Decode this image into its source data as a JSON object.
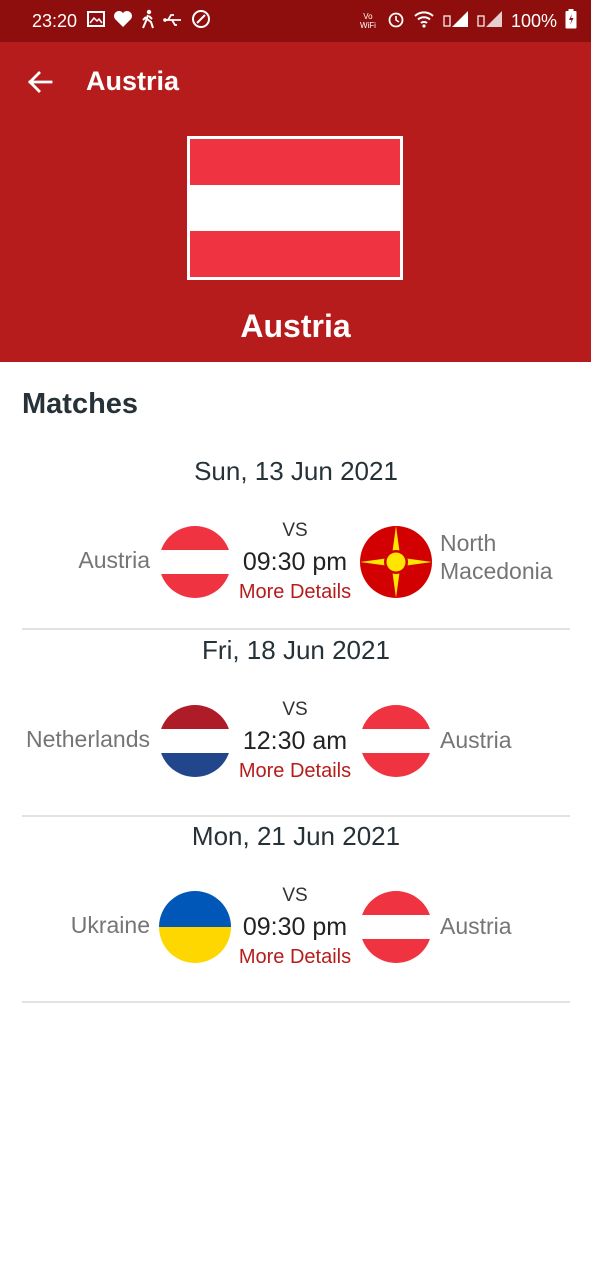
{
  "status_bar": {
    "time": "23:20",
    "battery": "100%",
    "left_icons": [
      "image-icon",
      "heart-icon",
      "walk-icon",
      "usb-icon",
      "data-saver-icon"
    ],
    "right_icons": [
      "vowifi-icon",
      "alarm-icon",
      "wifi-icon",
      "signal-icon",
      "signal-icon",
      "battery-icon"
    ],
    "vowifi_label": "Vo WiFi"
  },
  "toolbar": {
    "title": "Austria"
  },
  "header": {
    "country_name": "Austria",
    "flag_colors": [
      "#ef3340",
      "#ffffff",
      "#ef3340"
    ]
  },
  "section": {
    "title": "Matches"
  },
  "matches": [
    {
      "date": "Sun, 13 Jun 2021",
      "home_team": "Austria",
      "away_team_line1": "North",
      "away_team_line2": "Macedonia",
      "vs": "VS",
      "time": "09:30 pm",
      "details_label": "More Details"
    },
    {
      "date": "Fri, 18 Jun 2021",
      "home_team": "Netherlands",
      "away_team": "Austria",
      "vs": "VS",
      "time": "12:30 am",
      "details_label": "More Details"
    },
    {
      "date": "Mon, 21 Jun 2021",
      "home_team": "Ukraine",
      "away_team": "Austria",
      "vs": "VS",
      "time": "09:30 pm",
      "details_label": "More Details"
    }
  ],
  "colors": {
    "primary": "#b71c1c",
    "status_bar": "#8e0e0e",
    "austria_red": "#ef3340",
    "netherlands": [
      "#ae1c28",
      "#ffffff",
      "#21468b"
    ],
    "ukraine": [
      "#0057b8",
      "#ffd700"
    ],
    "north_macedonia": [
      "#d20000",
      "#ffe600"
    ]
  }
}
